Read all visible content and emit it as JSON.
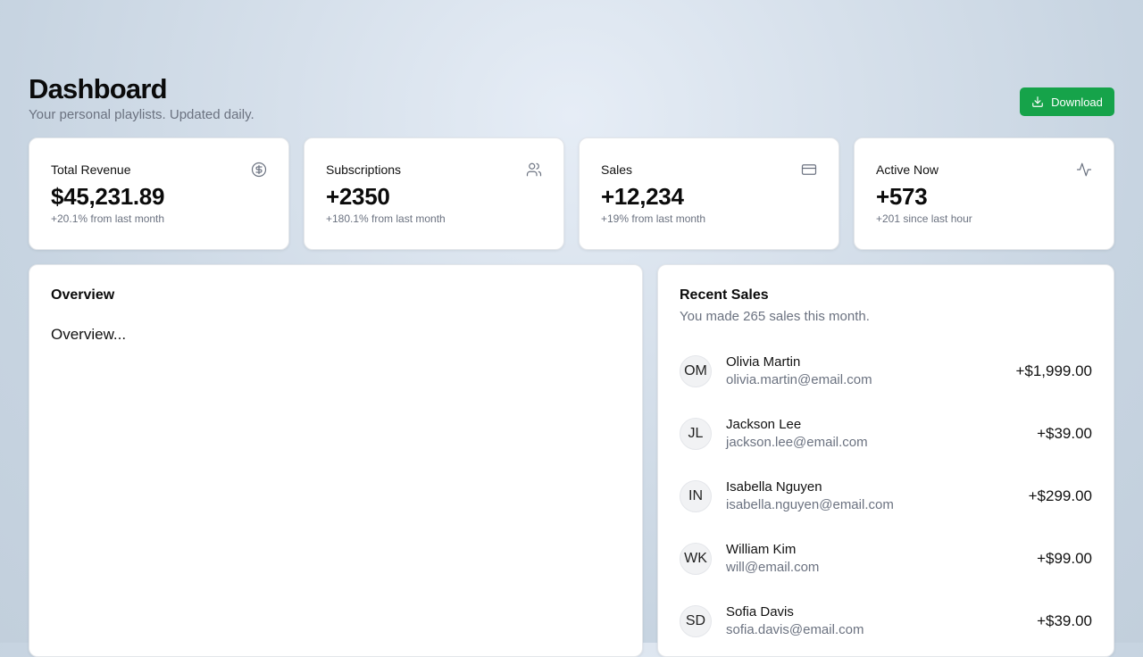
{
  "header": {
    "title": "Dashboard",
    "subtitle": "Your personal playlists. Updated daily.",
    "download_label": "Download"
  },
  "stats": [
    {
      "title": "Total Revenue",
      "value": "$45,231.89",
      "note": "+20.1% from last month",
      "icon": "dollar-icon"
    },
    {
      "title": "Subscriptions",
      "value": "+2350",
      "note": "+180.1% from last month",
      "icon": "users-icon"
    },
    {
      "title": "Sales",
      "value": "+12,234",
      "note": "+19% from last month",
      "icon": "credit-card-icon"
    },
    {
      "title": "Active Now",
      "value": "+573",
      "note": "+201 since last hour",
      "icon": "activity-icon"
    }
  ],
  "overview": {
    "title": "Overview",
    "placeholder": "Overview..."
  },
  "recent_sales": {
    "title": "Recent Sales",
    "subtitle": "You made 265 sales this month.",
    "items": [
      {
        "initials": "OM",
        "name": "Olivia Martin",
        "email": "olivia.martin@email.com",
        "amount": "+$1,999.00"
      },
      {
        "initials": "JL",
        "name": "Jackson Lee",
        "email": "jackson.lee@email.com",
        "amount": "+$39.00"
      },
      {
        "initials": "IN",
        "name": "Isabella Nguyen",
        "email": "isabella.nguyen@email.com",
        "amount": "+$299.00"
      },
      {
        "initials": "WK",
        "name": "William Kim",
        "email": "will@email.com",
        "amount": "+$99.00"
      },
      {
        "initials": "SD",
        "name": "Sofia Davis",
        "email": "sofia.davis@email.com",
        "amount": "+$39.00"
      }
    ]
  },
  "colors": {
    "accent": "#16a34a",
    "muted_text": "#6b7280"
  }
}
